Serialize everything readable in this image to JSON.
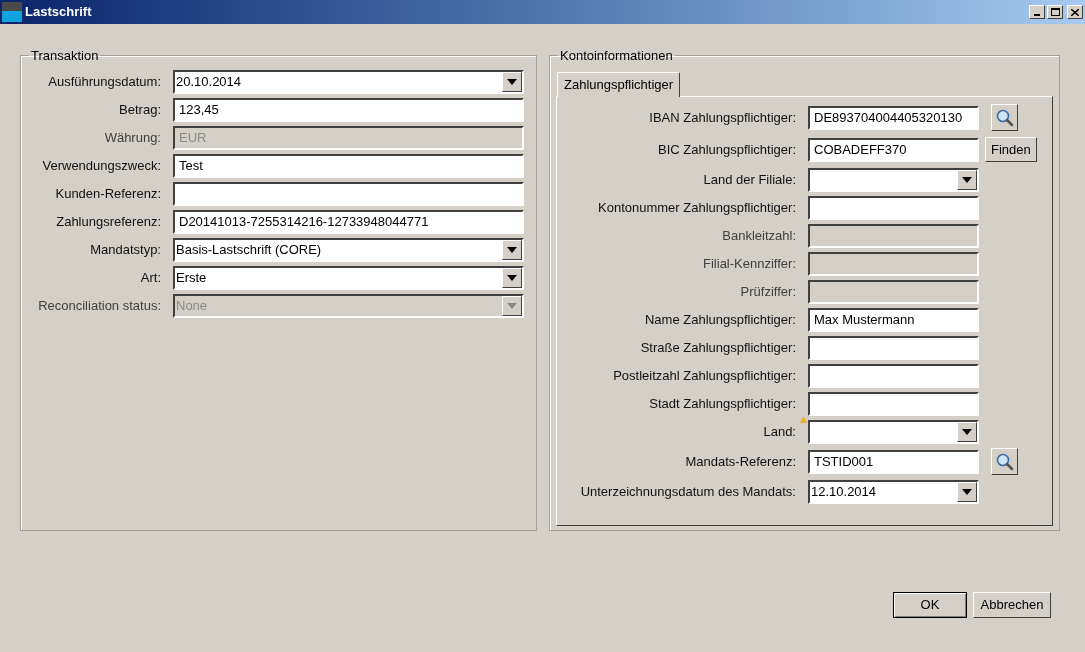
{
  "window": {
    "title": "Lastschrift"
  },
  "transaktion": {
    "title": "Transaktion",
    "fields": [
      {
        "label": "Ausführungsdatum:",
        "kind": "combo",
        "value": "20.10.2014",
        "disabled": false
      },
      {
        "label": "Betrag:",
        "kind": "text",
        "value": "123,45",
        "disabled": false
      },
      {
        "label": "Währung:",
        "kind": "text",
        "value": "EUR",
        "disabled": true
      },
      {
        "label": "Verwendungszweck:",
        "kind": "text",
        "value": "Test",
        "disabled": false
      },
      {
        "label": "Kunden-Referenz:",
        "kind": "text",
        "disabled": false
      },
      {
        "label": "Zahlungsreferenz:",
        "kind": "text",
        "value": "D20141013-7255314216-12733948044771",
        "disabled": false
      },
      {
        "label": "Mandatstyp:",
        "kind": "combo",
        "value": "Basis-Lastschrift (CORE)",
        "disabled": false
      },
      {
        "label": "Art:",
        "kind": "combo",
        "value": "Erste",
        "disabled": false
      },
      {
        "label": "Reconciliation status:",
        "kind": "combo",
        "value": "None",
        "disabled": true
      }
    ]
  },
  "kontoinformationen": {
    "title": "Kontoinformationen",
    "tabs": [
      {
        "label": "Zahlungspflichtiger",
        "selected": true
      }
    ],
    "fields": [
      {
        "label": "IBAN Zahlungspflichtiger:",
        "kind": "text",
        "value": "DE893704004405320130",
        "disabled": false,
        "action": {
          "kind": "search"
        }
      },
      {
        "label": "BIC Zahlungspflichtiger:",
        "kind": "text",
        "value": "COBADEFF370",
        "disabled": false,
        "action": {
          "kind": "button",
          "label": "Finden"
        }
      },
      {
        "label": "Land der Filiale:",
        "kind": "combo",
        "disabled": false
      },
      {
        "label": "Kontonummer Zahlungspflichtiger:",
        "kind": "text",
        "disabled": false
      },
      {
        "label": "Bankleitzahl:",
        "kind": "text",
        "disabled": true
      },
      {
        "label": "Filial-Kennziffer:",
        "kind": "text",
        "disabled": true
      },
      {
        "label": "Prüfziffer:",
        "kind": "text",
        "disabled": true
      },
      {
        "label": "Name Zahlungspflichtiger:",
        "kind": "text",
        "value": "Max Mustermann",
        "disabled": false
      },
      {
        "label": "Straße Zahlungspflichtiger:",
        "kind": "text",
        "disabled": false
      },
      {
        "label": "Postleitzahl Zahlungspflichtiger:",
        "kind": "text",
        "disabled": false
      },
      {
        "label": "Stadt Zahlungspflichtiger:",
        "kind": "text",
        "disabled": false
      },
      {
        "label": "Land:",
        "kind": "combo",
        "disabled": false,
        "warning": true
      },
      {
        "label": "Mandats-Referenz:",
        "kind": "text",
        "value": "TSTID001",
        "disabled": false,
        "action": {
          "kind": "search"
        }
      },
      {
        "label": "Unterzeichnungsdatum des Mandats:",
        "kind": "combo",
        "value": "12.10.2014",
        "disabled": false
      }
    ]
  },
  "buttons": [
    "OK",
    "Abbrechen"
  ]
}
